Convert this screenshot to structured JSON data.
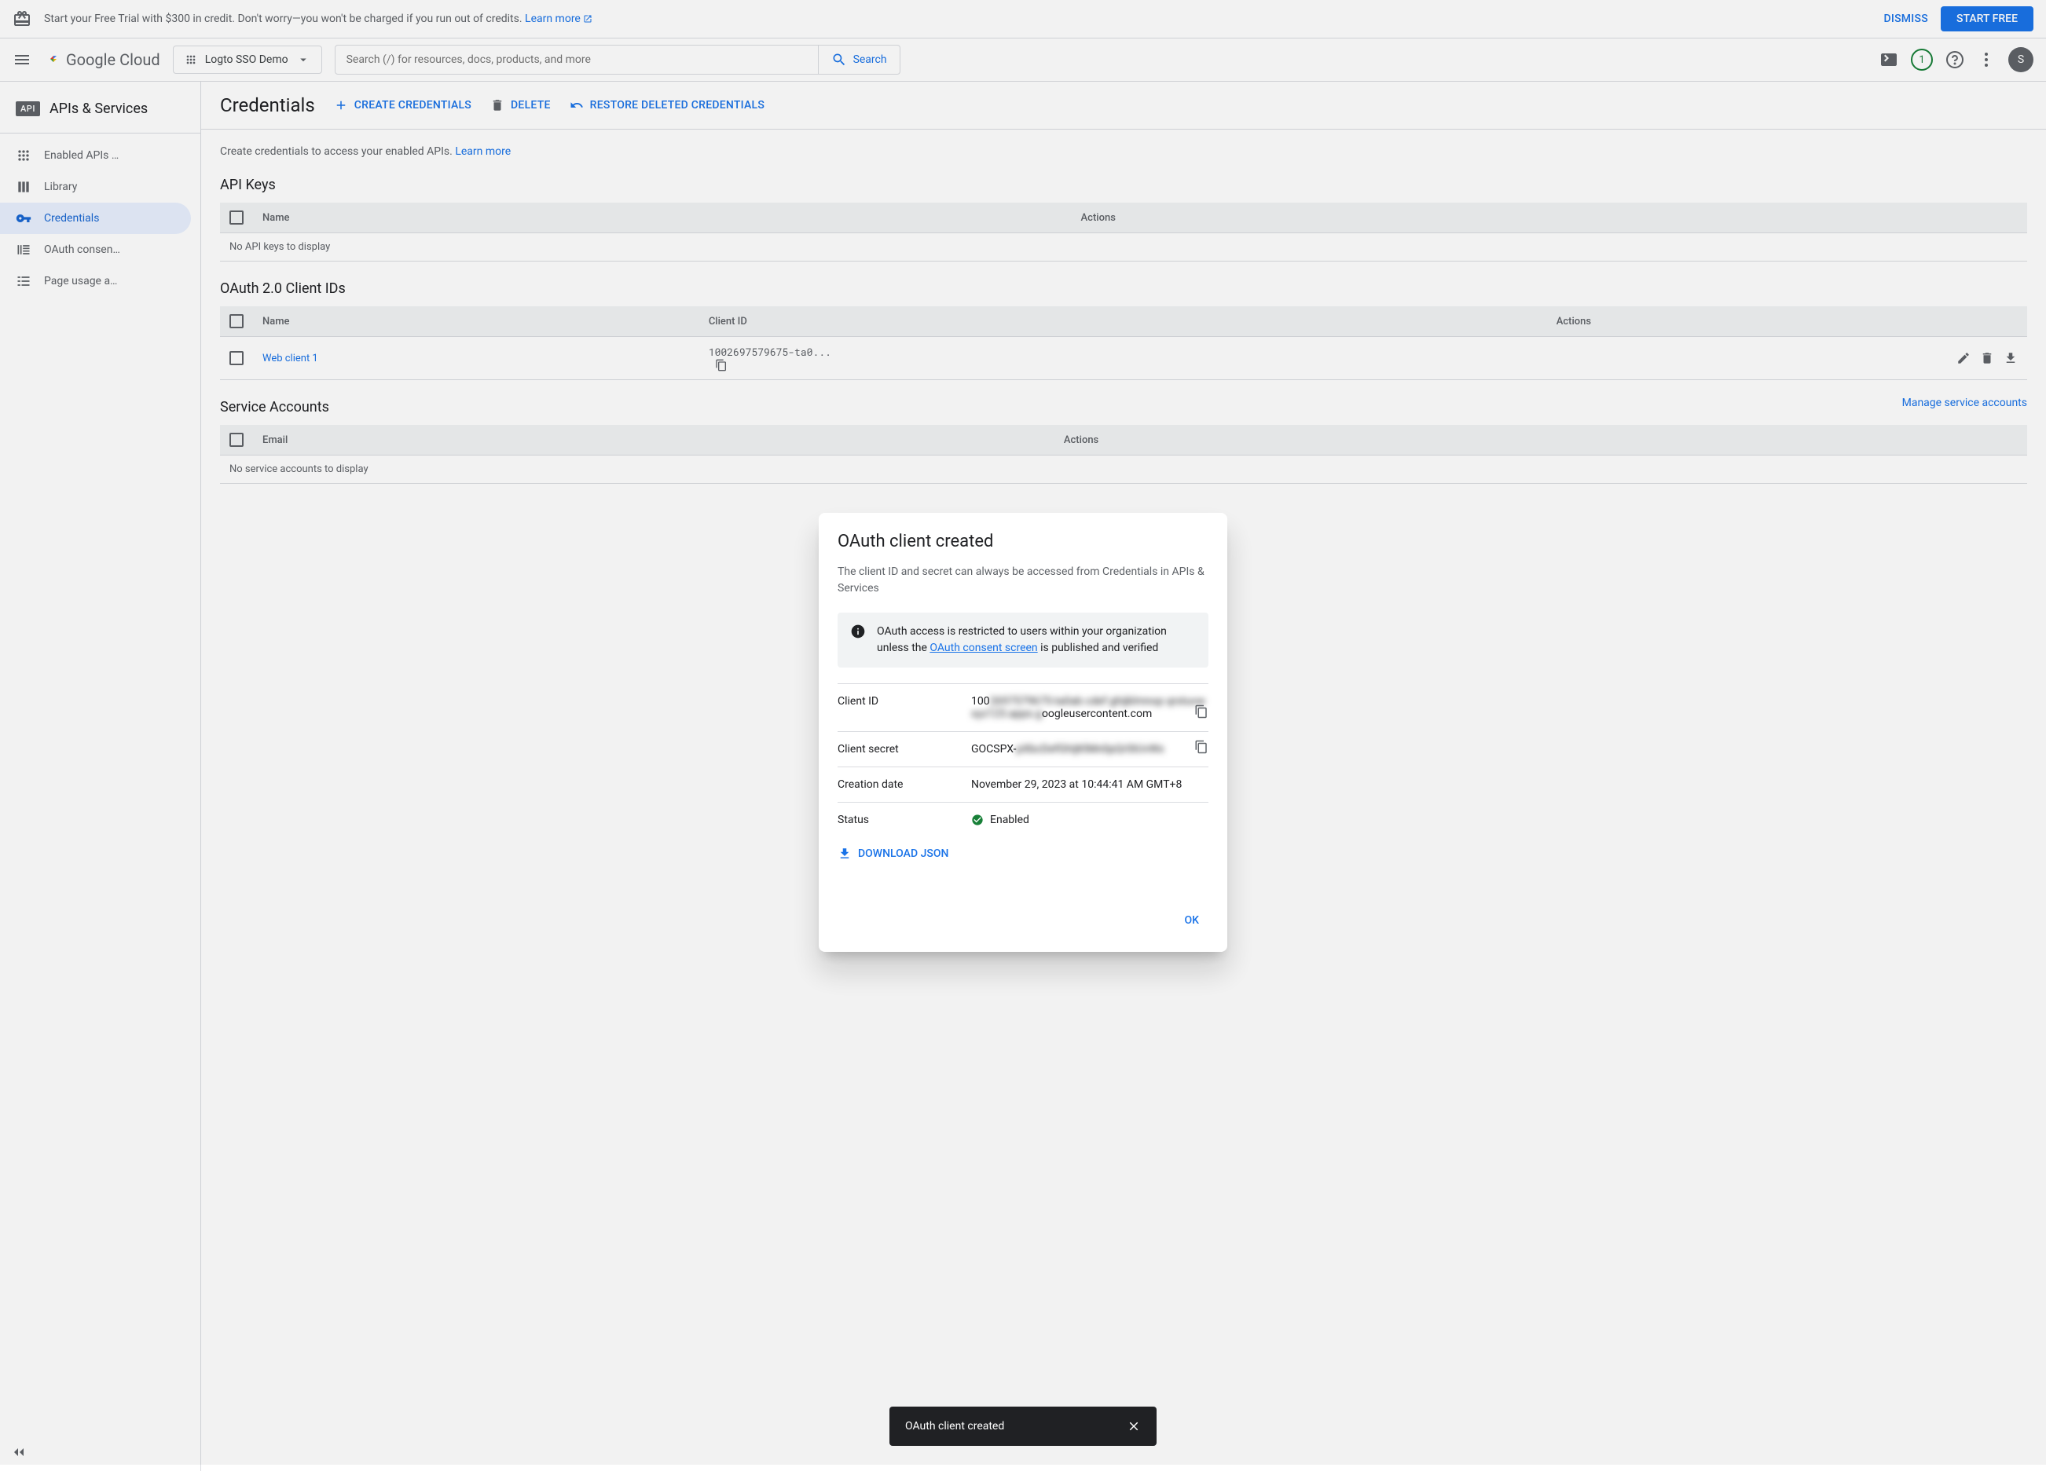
{
  "banner": {
    "text": "Start your Free Trial with $300 in credit. Don't worry—you won't be charged if you run out of credits. ",
    "learn_more": "Learn more",
    "dismiss": "DISMISS",
    "start_free": "START FREE"
  },
  "header": {
    "logo_text": "Google Cloud",
    "project_name": "Logto SSO Demo",
    "search_placeholder": "Search (/) for resources, docs, products, and more",
    "search_label": "Search",
    "badge_count": "1",
    "avatar_initial": "S"
  },
  "sidebar": {
    "title": "APIs & Services",
    "badge": "API",
    "items": [
      {
        "label": "Enabled APIs …",
        "icon": "dashboard"
      },
      {
        "label": "Library",
        "icon": "library"
      },
      {
        "label": "Credentials",
        "icon": "key",
        "active": true
      },
      {
        "label": "OAuth consen…",
        "icon": "consent"
      },
      {
        "label": "Page usage a…",
        "icon": "checklist"
      }
    ]
  },
  "page": {
    "title": "Credentials",
    "create_btn": "CREATE CREDENTIALS",
    "delete_btn": "DELETE",
    "restore_btn": "RESTORE DELETED CREDENTIALS",
    "intro": "Create credentials to access your enabled APIs. ",
    "intro_link": "Learn more"
  },
  "api_keys": {
    "title": "API Keys",
    "cols": {
      "name": "Name",
      "actions": "Actions"
    },
    "empty": "No API keys to display"
  },
  "oauth_clients": {
    "title": "OAuth 2.0 Client IDs",
    "cols": {
      "name": "Name",
      "client_id": "Client ID",
      "actions": "Actions"
    },
    "rows": [
      {
        "name": "Web client 1",
        "client_id": "1002697579675-ta0..."
      }
    ]
  },
  "service_accounts": {
    "title": "Service Accounts",
    "manage_link": "Manage service accounts",
    "cols": {
      "email": "Email",
      "actions": "Actions"
    },
    "empty": "No service accounts to display"
  },
  "modal": {
    "title": "OAuth client created",
    "description": "The client ID and secret can always be accessed from Credentials in APIs & Services",
    "info_prefix": "OAuth access is restricted to users within your organization unless the ",
    "info_link": "OAuth consent screen",
    "info_suffix": " is published and verified",
    "labels": {
      "client_id": "Client ID",
      "client_secret": "Client secret",
      "creation_date": "Creation date",
      "status": "Status"
    },
    "values": {
      "client_id_prefix": "100",
      "client_id_blurred": "2697579675-ta0ab cdef ghijklmnop qrstuvwxyz123.apps.g",
      "client_id_suffix": "oogleusercontent.com",
      "client_secret_prefix": "GOCSPX-",
      "client_secret_blurred": "pXbcDefGhIjKlMn0pQrStUvWx",
      "creation_date": "November 29, 2023 at 10:44:41 AM GMT+8",
      "status": "Enabled"
    },
    "download_btn": "DOWNLOAD JSON",
    "ok_btn": "OK"
  },
  "toast": {
    "message": "OAuth client created"
  }
}
